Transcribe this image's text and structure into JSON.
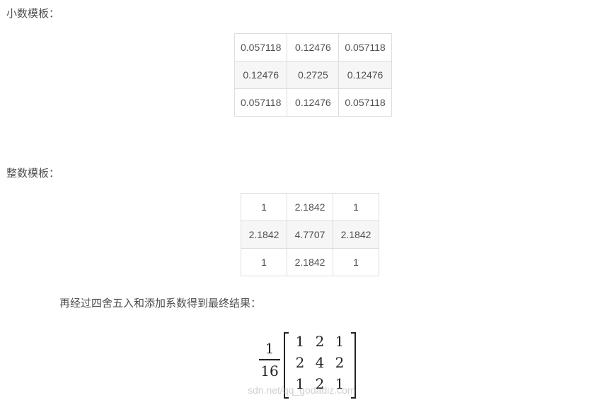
{
  "labels": {
    "decimal_template": "小数模板：",
    "integer_template": "整数模板：",
    "final_step": "再经过四舍五入和添加系数得到最终结果："
  },
  "decimal_table": [
    [
      "0.057118",
      "0.12476",
      "0.057118"
    ],
    [
      "0.12476",
      "0.2725",
      "0.12476"
    ],
    [
      "0.057118",
      "0.12476",
      "0.057118"
    ]
  ],
  "integer_table": [
    [
      "1",
      "2.1842",
      "1"
    ],
    [
      "2.1842",
      "4.7707",
      "2.1842"
    ],
    [
      "1",
      "2.1842",
      "1"
    ]
  ],
  "formula": {
    "numerator": "1",
    "denominator": "16",
    "matrix": [
      [
        "1",
        "2",
        "1"
      ],
      [
        "2",
        "4",
        "2"
      ],
      [
        "1",
        "2",
        "1"
      ]
    ]
  },
  "watermark": "sdn.net/qq_godadiz.com"
}
